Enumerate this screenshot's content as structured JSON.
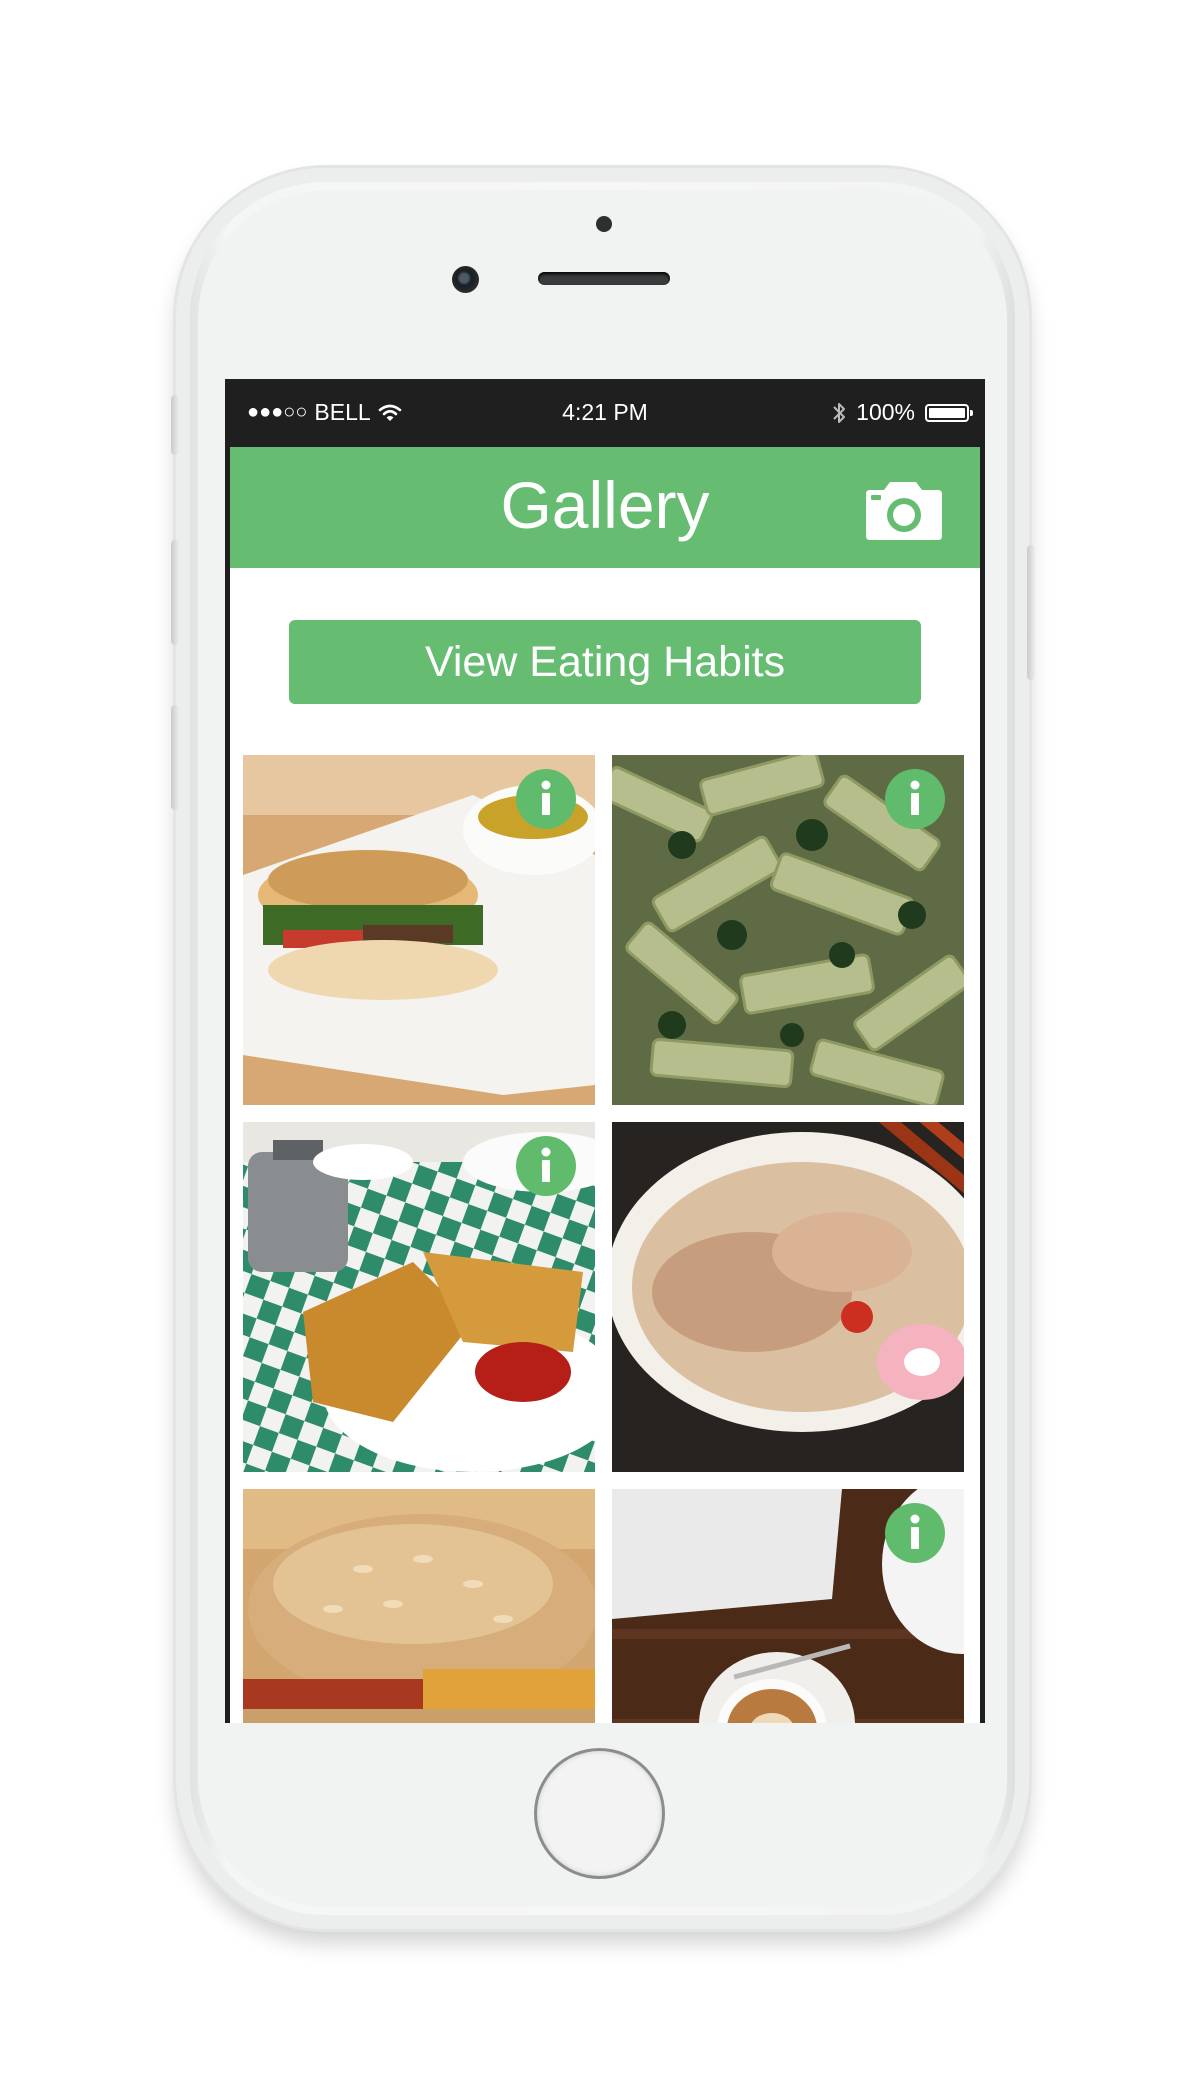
{
  "status_bar": {
    "signal": "●●●○○",
    "carrier": "BELL",
    "time": "4:21 PM",
    "battery": "100%"
  },
  "header": {
    "title": "Gallery",
    "camera_icon": "camera-icon"
  },
  "cta": {
    "label": "View Eating Habits"
  },
  "gallery": {
    "photos": [
      {
        "subject": "sandwich-with-soup",
        "info_badge": true
      },
      {
        "subject": "pesto-penne-pasta",
        "info_badge": true
      },
      {
        "subject": "grilled-cheese-with-ketchup",
        "info_badge": true
      },
      {
        "subject": "ramen-bowl",
        "info_badge": false
      },
      {
        "subject": "burger",
        "info_badge": false
      },
      {
        "subject": "latte-coffee",
        "info_badge": true
      }
    ]
  },
  "colors": {
    "accent": "#66bc70",
    "status_bar": "#1f1f20"
  }
}
